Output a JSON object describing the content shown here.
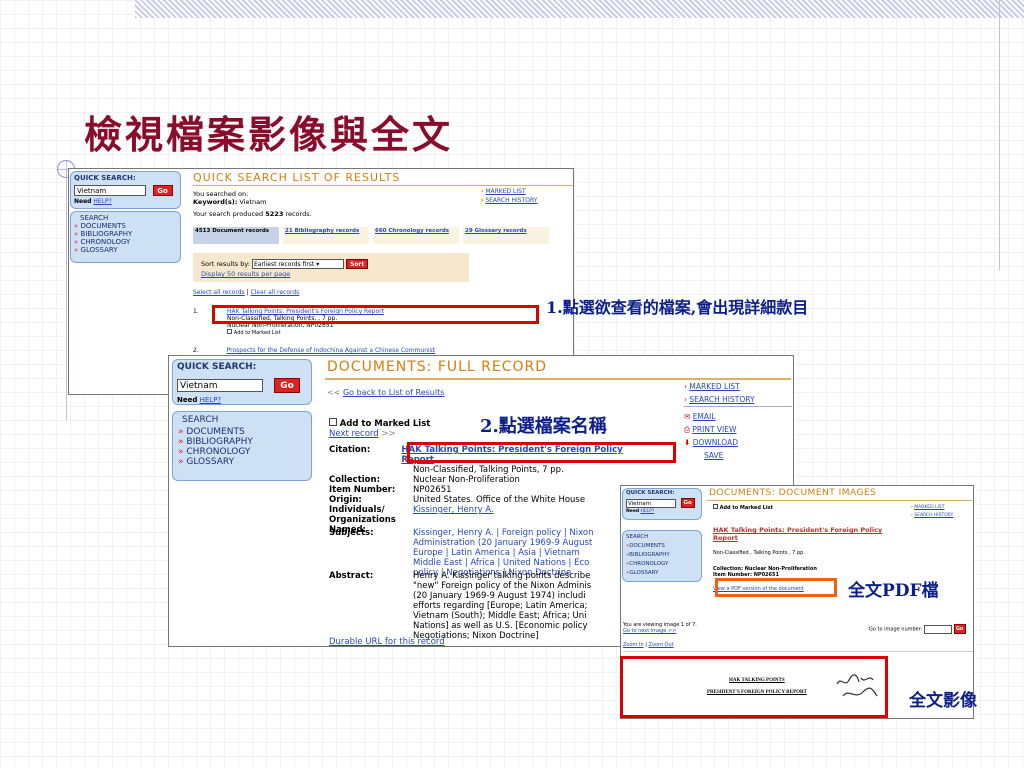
{
  "slide": {
    "title": "檢視檔案影像與全文"
  },
  "annotations": {
    "step1": "1.點選欲查看的檔案,會出現詳細款目",
    "step2": "2.點選檔案名稱",
    "pdf": "全文PDF檔",
    "image": "全文影像"
  },
  "shot1": {
    "qs_header": "QUICK SEARCH:",
    "search_value": "Vietnam",
    "go": "Go",
    "need": "Need",
    "help": "HELP?",
    "nav_header": "SEARCH",
    "nav": [
      "DOCUMENTS",
      "BIBLIOGRAPHY",
      "CHRONOLOGY",
      "GLOSSARY"
    ],
    "page_title": "QUICK SEARCH LIST OF RESULTS",
    "searched_on": "You searched on:",
    "keyword_label": "Keyword(s):",
    "keyword_value": "Vietnam",
    "produced_prefix": "Your search produced",
    "produced_count": "5223",
    "produced_suffix": "records.",
    "marked_list": "MARKED LIST",
    "search_history": "SEARCH HISTORY",
    "tabs": [
      "4513 Document records",
      "21 Bibliography records",
      "660 Chronology records",
      "29 Glossary records"
    ],
    "sort_label": "Sort results by:",
    "sort_value": "Earliest records first",
    "sort_button": "Sort",
    "display50": "Display 50 results per page",
    "select_all": "Select all records",
    "clear_all": "Clear all records",
    "item1_num": "1.",
    "item1_title": "HAK Talking Points: President's Foreign Policy Report",
    "item1_meta": "Non-Classified, Talking Points, , 7 pp.",
    "item1_meta2": "Nuclear Non-Proliferation, NP02651",
    "add_marked": "Add to Marked List",
    "item2_num": "2.",
    "item2_title": "Prospects for the Defense of Indochina Against a Chinese Communist"
  },
  "shot2": {
    "qs_header": "QUICK SEARCH:",
    "search_value": "Vietnam",
    "go": "Go",
    "need": "Need",
    "help": "HELP?",
    "nav_header": "SEARCH",
    "nav": [
      "DOCUMENTS",
      "BIBLIOGRAPHY",
      "CHRONOLOGY",
      "GLOSSARY"
    ],
    "page_title": "DOCUMENTS: FULL RECORD",
    "back": "Go back to List of Results",
    "add_marked": "Add to Marked List",
    "next_record": "Next record",
    "side_links": [
      "MARKED LIST",
      "SEARCH HISTORY",
      "EMAIL",
      "PRINT VIEW",
      "DOWNLOAD",
      "SAVE"
    ],
    "fields": [
      {
        "label": "Citation:",
        "value": "HAK Talking Points: President's Foreign Policy Report"
      },
      {
        "label": "",
        "value": "Non-Classified, Talking Points, 7 pp."
      },
      {
        "label": "Collection:",
        "value": "Nuclear Non-Proliferation"
      },
      {
        "label": "Item Number:",
        "value": "NP02651"
      },
      {
        "label": "Origin:",
        "value": "United States. Office of the White House"
      },
      {
        "label": "Individuals/",
        "value": "Kissinger, Henry A."
      },
      {
        "label": "Organizations",
        "value": ""
      },
      {
        "label": "Named:",
        "value": ""
      }
    ],
    "subjects_label": "Subjects:",
    "subjects_lines": [
      "Kissinger, Henry A. | Foreign policy | Nixon",
      "Administration (20 January 1969-9 August",
      "Europe | Latin America | Asia | Vietnam",
      "Middle East | Africa | United Nations | Eco",
      "policy | Negotiations | Nixon Doctrine"
    ],
    "abstract_label": "Abstract:",
    "abstract_lines": [
      "Henry A. Kissinger talking points describe",
      "\"new\" Foreign policy of the Nixon Adminis",
      "(20 January 1969-9 August 1974) includi",
      "efforts regarding [Europe; Latin America;",
      "Vietnam (South); Middle East; Africa; Uni",
      "Nations] as well as U.S. [Economic policy",
      "Negotiations; Nixon Doctrine]"
    ],
    "durable": "Durable URL for this record"
  },
  "shot3": {
    "qs_header": "QUICK SEARCH:",
    "search_value": "Vietnam",
    "go": "Go",
    "need": "Need",
    "help": "HELP?",
    "nav_header": "SEARCH",
    "nav": [
      "DOCUMENTS",
      "BIBLIOGRAPHY",
      "CHRONOLOGY",
      "GLOSSARY"
    ],
    "page_title": "DOCUMENTS: DOCUMENT IMAGES",
    "marked_list": "MARKED LIST",
    "search_history": "SEARCH HISTORY",
    "add_marked": "Add to Marked List",
    "doc_title": "HAK Talking Points: President's Foreign Policy Report",
    "doc_meta": "Non-Classified , Talking Points , 7 pp.",
    "collection": "Collection: Nuclear Non-Proliferation",
    "item_number": "Item Number: NP02651",
    "pdf_link": "View a PDF version of the document",
    "viewing": "You are viewing image 1 of 7.",
    "next_image": "Go to next image >>",
    "goto_label": "Go to image number:",
    "go2": "Go",
    "zoom_in": "Zoom In",
    "zoom_out": "Zoom Out",
    "doc_line1": "HAK TALKING POINTS",
    "doc_line2": "PRESIDENT'S FOREIGN POLICY REPORT"
  }
}
